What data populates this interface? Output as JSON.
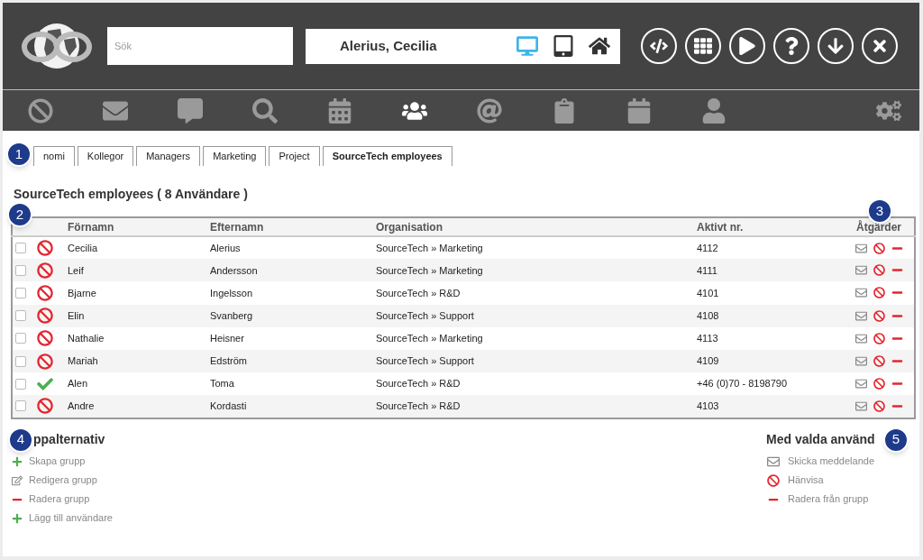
{
  "header": {
    "search": {
      "placeholder": "Sök"
    },
    "user_name": "Alerius, Cecilia",
    "devices": [
      {
        "selected": true
      },
      {
        "selected": false
      },
      {
        "selected": false
      }
    ]
  },
  "nav": [
    {
      "selected": false
    },
    {
      "selected": false
    },
    {
      "selected": false
    },
    {
      "selected": false
    },
    {
      "selected": false
    },
    {
      "selected": true
    },
    {
      "selected": false
    },
    {
      "selected": false
    },
    {
      "selected": false
    },
    {
      "selected": false
    }
  ],
  "tabs": [
    {
      "label": "nomi",
      "selected": false
    },
    {
      "label": "Kollegor",
      "selected": false
    },
    {
      "label": "Managers",
      "selected": false
    },
    {
      "label": "Marketing",
      "selected": false
    },
    {
      "label": "Project",
      "selected": false
    },
    {
      "label": "SourceTech employees",
      "selected": true
    }
  ],
  "title": "SourceTech employees ( 8 Användare )",
  "table": {
    "columns": [
      "Förnamn",
      "Efternamn",
      "Organisation",
      "Aktivt nr.",
      "Åtgärder"
    ],
    "rows": [
      {
        "checked": false,
        "kind": "blocked",
        "first": "Cecilia",
        "last": "Alerius",
        "org": "SourceTech » Marketing",
        "number": "4112"
      },
      {
        "checked": false,
        "kind": "blocked",
        "first": "Leif",
        "last": "Andersson",
        "org": "SourceTech » Marketing",
        "number": "4111"
      },
      {
        "checked": false,
        "kind": "blocked",
        "first": "Bjarne",
        "last": "Ingelsson",
        "org": "SourceTech » R&D",
        "number": "4101"
      },
      {
        "checked": false,
        "kind": "blocked",
        "first": "Elin",
        "last": "Svanberg",
        "org": "SourceTech » Support",
        "number": "4108"
      },
      {
        "checked": false,
        "kind": "blocked",
        "first": "Nathalie",
        "last": "Heisner",
        "org": "SourceTech » Marketing",
        "number": "4113"
      },
      {
        "checked": false,
        "kind": "blocked",
        "first": "Mariah",
        "last": "Edström",
        "org": "SourceTech » Support",
        "number": "4109"
      },
      {
        "checked": false,
        "kind": "active",
        "first": "Alen",
        "last": "Toma",
        "org": "SourceTech » R&D",
        "number": "+46 (0)70 - 8198790"
      },
      {
        "checked": false,
        "kind": "blocked",
        "first": "Andre",
        "last": "Kordasti",
        "org": "SourceTech » R&D",
        "number": "4103"
      }
    ]
  },
  "group_options": {
    "title": "ppalternativ",
    "items": [
      {
        "kind": "add",
        "label": "Skapa grupp"
      },
      {
        "kind": "edit",
        "label": "Redigera grupp"
      },
      {
        "kind": "remove",
        "label": "Radera grupp"
      },
      {
        "kind": "add",
        "label": "Lägg till användare"
      }
    ]
  },
  "selected_options": {
    "title": "Med valda använd",
    "items": [
      {
        "kind": "mail",
        "label": "Skicka meddelande"
      },
      {
        "kind": "block",
        "label": "Hänvisa"
      },
      {
        "kind": "remove",
        "label": "Radera från grupp"
      }
    ]
  },
  "callouts": [
    "1",
    "2",
    "3",
    "4",
    "5"
  ]
}
